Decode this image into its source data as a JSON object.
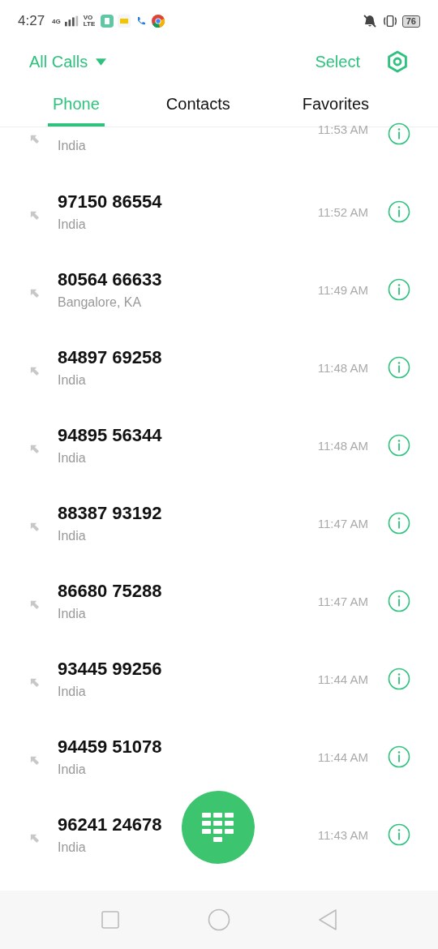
{
  "status_bar": {
    "time": "4:27",
    "network": "4G",
    "volte": "VO LTE",
    "battery": "76"
  },
  "header": {
    "filter": "All Calls",
    "select": "Select"
  },
  "tabs": [
    {
      "label": "Phone",
      "selected": true
    },
    {
      "label": "Contacts",
      "selected": false
    },
    {
      "label": "Favorites",
      "selected": false
    }
  ],
  "calls": [
    {
      "location": "India",
      "time": "11:53 AM"
    },
    {
      "number": "97150 86554",
      "location": "India",
      "time": "11:52 AM"
    },
    {
      "number": "80564 66633",
      "location": "Bangalore, KA",
      "time": "11:49 AM"
    },
    {
      "number": "84897 69258",
      "location": "India",
      "time": "11:48 AM"
    },
    {
      "number": "94895 56344",
      "location": "India",
      "time": "11:48 AM"
    },
    {
      "number": "88387 93192",
      "location": "India",
      "time": "11:47 AM"
    },
    {
      "number": "86680 75288",
      "location": "India",
      "time": "11:47 AM"
    },
    {
      "number": "93445 99256",
      "location": "India",
      "time": "11:44 AM"
    },
    {
      "number": "94459 51078",
      "location": "India",
      "time": "11:44 AM"
    },
    {
      "number": "96241 24678",
      "location": "India",
      "time": "11:43 AM"
    }
  ]
}
